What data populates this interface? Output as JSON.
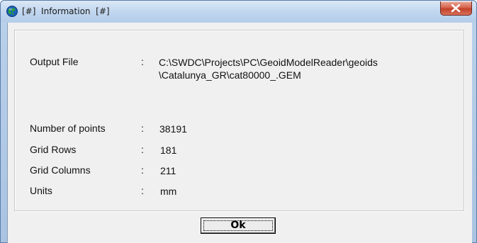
{
  "window": {
    "title": "[#]  Information  [#]",
    "icon": "globe-icon",
    "close_icon": "close-icon"
  },
  "info": {
    "output_file": {
      "label": "Output File",
      "sep": ":",
      "value_line1": "C:\\SWDC\\Projects\\PC\\GeoidModelReader\\geoids",
      "value_line2": "\\Catalunya_GR\\cat80000_.GEM"
    },
    "number_of_points": {
      "label": "Number of points",
      "sep": ":",
      "value": "38191"
    },
    "grid_rows": {
      "label": "Grid Rows",
      "sep": ":",
      "value": "181"
    },
    "grid_columns": {
      "label": "Grid Columns",
      "sep": ":",
      "value": "211"
    },
    "units": {
      "label": "Units",
      "sep": ":",
      "value": "mm"
    }
  },
  "buttons": {
    "ok_label": "Ok"
  },
  "colors": {
    "close_red": "#c3402a",
    "frame_blue": "#b9d0ea",
    "client_bg": "#f0f0f0"
  }
}
